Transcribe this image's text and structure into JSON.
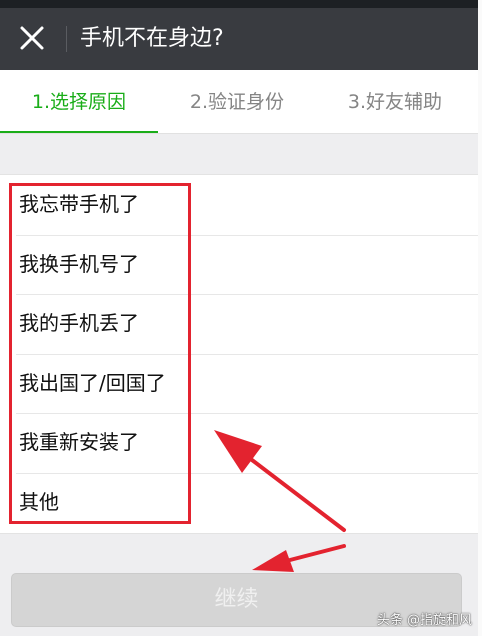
{
  "header": {
    "title": "手机不在身边?",
    "close_icon": "close-icon"
  },
  "tabs": [
    {
      "label": "1.选择原因",
      "active": true
    },
    {
      "label": "2.验证身份",
      "active": false
    },
    {
      "label": "3.好友辅助",
      "active": false
    }
  ],
  "reasons": [
    {
      "label": "我忘带手机了"
    },
    {
      "label": "我换手机号了"
    },
    {
      "label": "我的手机丢了"
    },
    {
      "label": "我出国了/回国了"
    },
    {
      "label": "我重新安装了"
    },
    {
      "label": "其他"
    }
  ],
  "footer": {
    "continue_label": "继续",
    "continue_enabled": false
  },
  "watermark": "头条 @指旋和风",
  "colors": {
    "topbar": "#393b40",
    "accent_green": "#1aad19",
    "annotation_red": "#e3232f",
    "button_disabled": "#d5d5d5"
  }
}
